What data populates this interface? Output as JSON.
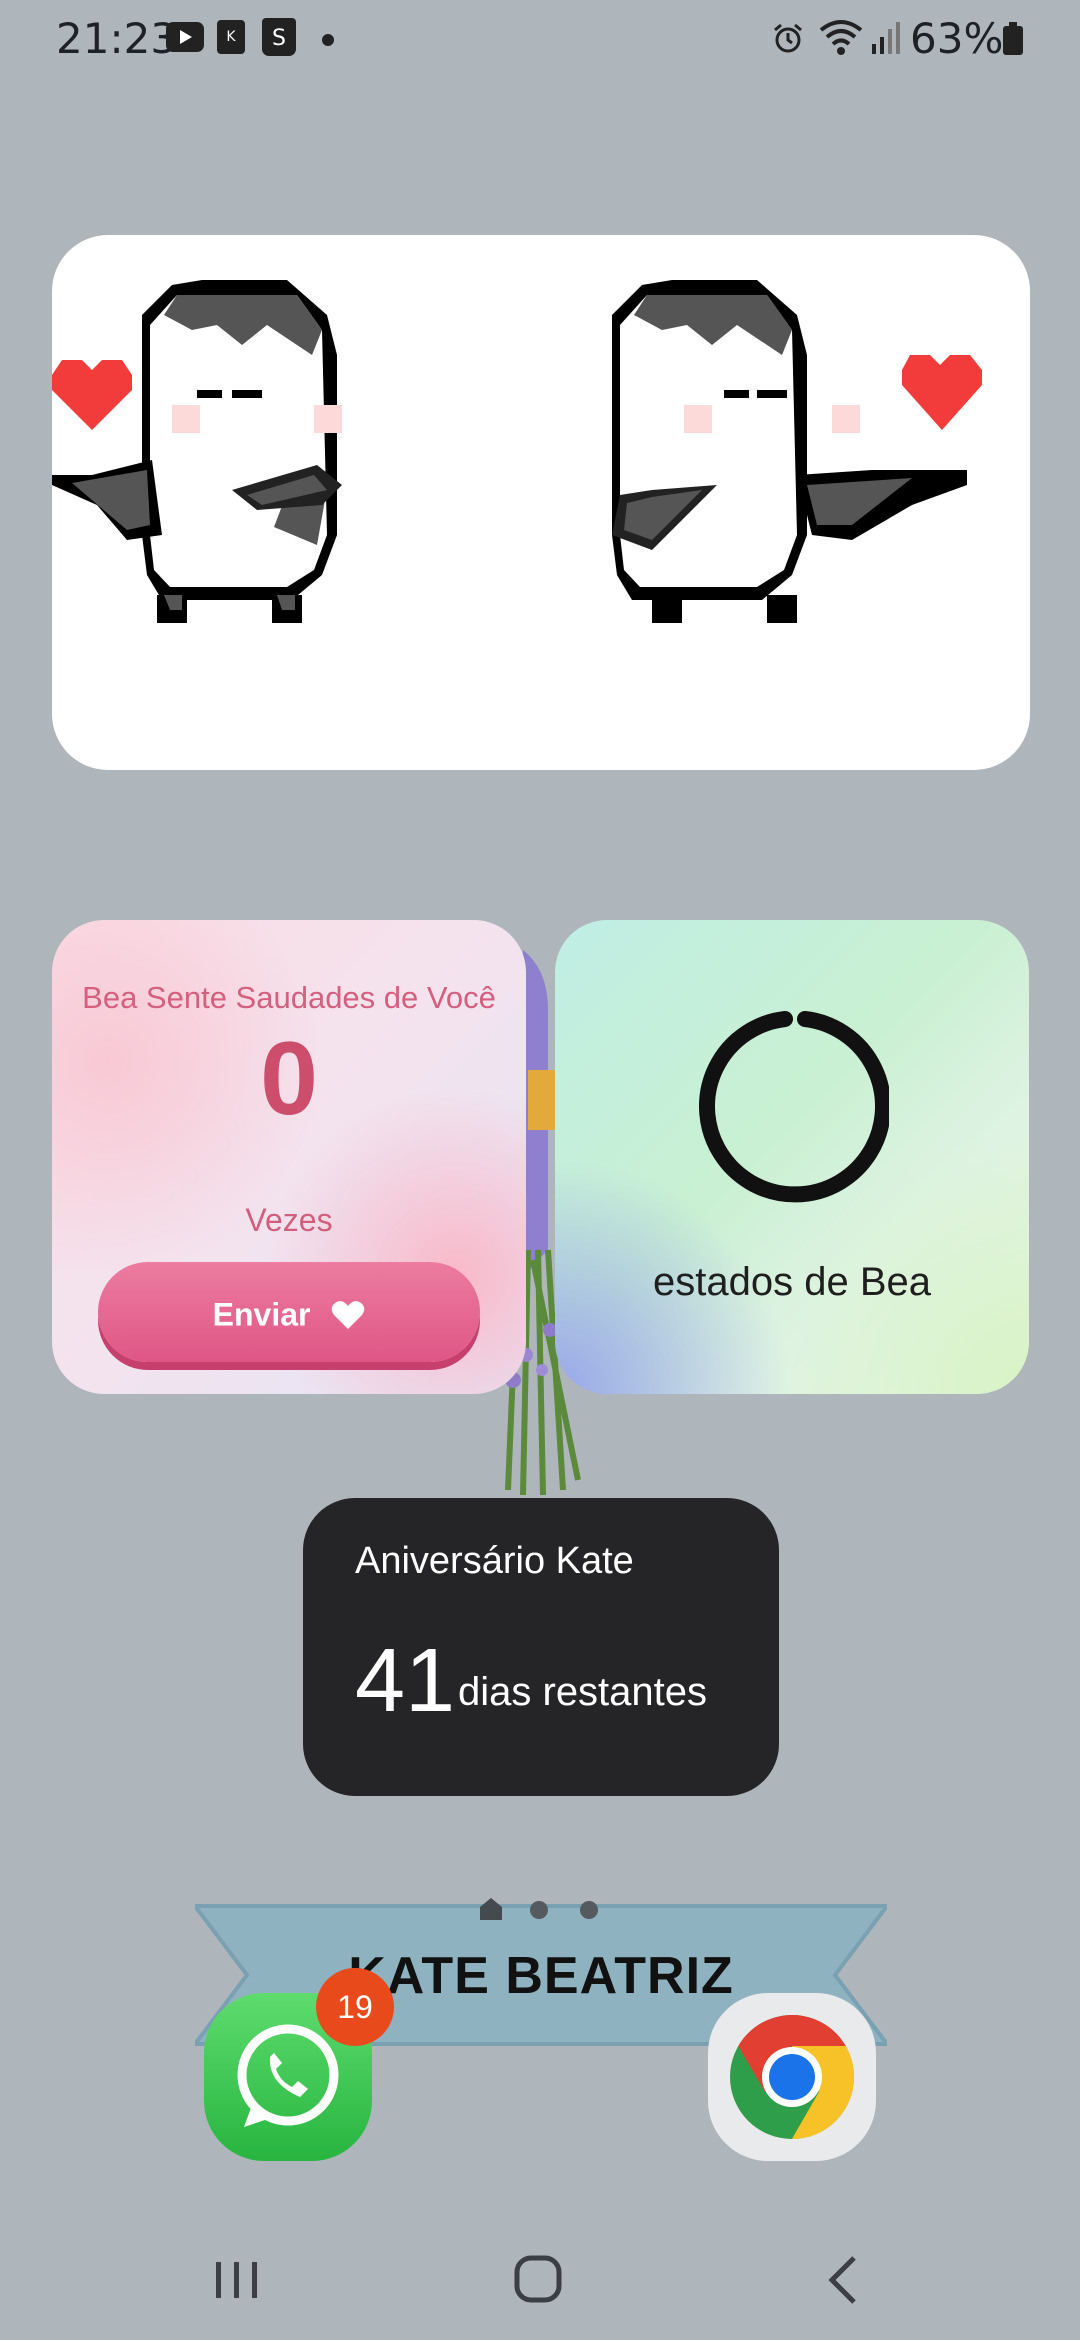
{
  "status_bar": {
    "time": "21:23",
    "battery": "63%",
    "notification_icons": [
      "youtube-icon",
      "k-app-icon",
      "shopee-icon",
      "dot-icon"
    ],
    "system_icons": [
      "alarm-icon",
      "wifi-icon",
      "signal-icon",
      "battery-icon"
    ]
  },
  "miss_widget": {
    "title": "Bea Sente Saudades de Você",
    "count": "0",
    "unit": "Vezes",
    "button_label": "Enviar"
  },
  "status_widget": {
    "label": "estados de Bea"
  },
  "countdown": {
    "title": "Aniversário Kate",
    "days": "41",
    "unit": "dias restantes"
  },
  "banner": {
    "name": "KATE BEATRIZ"
  },
  "dock": {
    "whatsapp_badge": "19"
  },
  "colors": {
    "background": "#aeb6bb",
    "accent_pink": "#df5686",
    "countdown_bg": "#252527",
    "badge": "#e84a1c"
  }
}
